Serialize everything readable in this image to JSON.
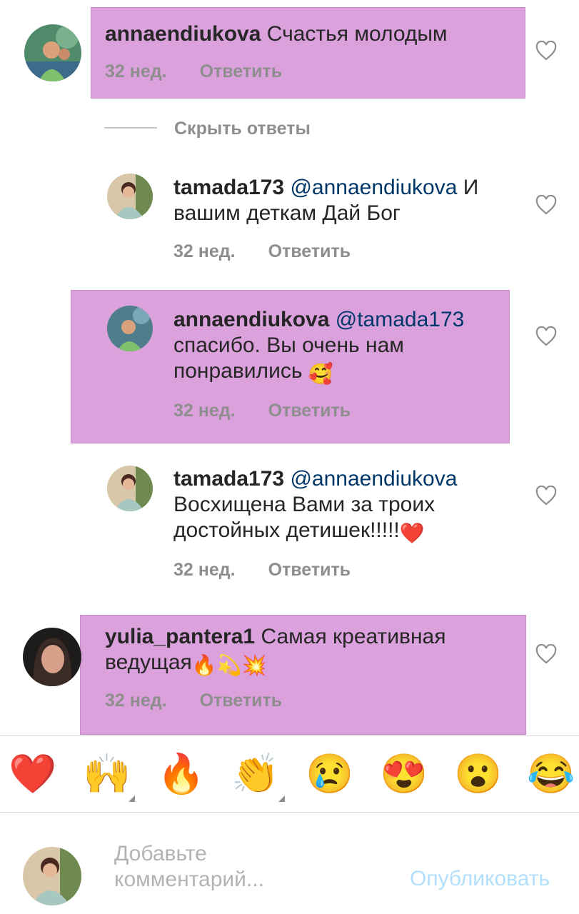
{
  "comments": [
    {
      "user": "annaendiukova",
      "text": "Счастья молодым",
      "time": "32 нед.",
      "reply": "Ответить"
    },
    {
      "user": "tamada173",
      "mention": "@annaendiukova",
      "text_a": "И",
      "text_b": "вашим деткам Дай Бог",
      "time": "32 нед.",
      "reply": "Ответить"
    },
    {
      "user": "annaendiukova",
      "mention": "@tamada173",
      "text_a": "спасибо. Вы очень нам",
      "text_b": "понравились",
      "emoji": "🥰",
      "time": "32 нед.",
      "reply": "Ответить"
    },
    {
      "user": "tamada173",
      "mention": "@annaendiukova",
      "text_a": "Восхищена Вами за троих",
      "text_b": "достойных детишек!!!!!",
      "emoji": "❤️",
      "time": "32 нед.",
      "reply": "Ответить"
    },
    {
      "user": "yulia_pantera1",
      "text_a": "Самая креативная",
      "text_b": "ведущая",
      "emoji": "🔥💫💥",
      "time": "32 нед.",
      "reply": "Ответить"
    }
  ],
  "hide_replies": "Скрыть ответы",
  "reactions": [
    "❤️",
    "🙌",
    "🔥",
    "👏",
    "😢",
    "😍",
    "😮",
    "😂"
  ],
  "composer": {
    "placeholder_line1": "Добавьте",
    "placeholder_line2": "комментарий...",
    "publish": "Опубликовать"
  },
  "colors": {
    "highlight": "#dba1dc",
    "mention": "#00376b",
    "meta": "#8e8e8e",
    "publish": "#b2dffc"
  }
}
